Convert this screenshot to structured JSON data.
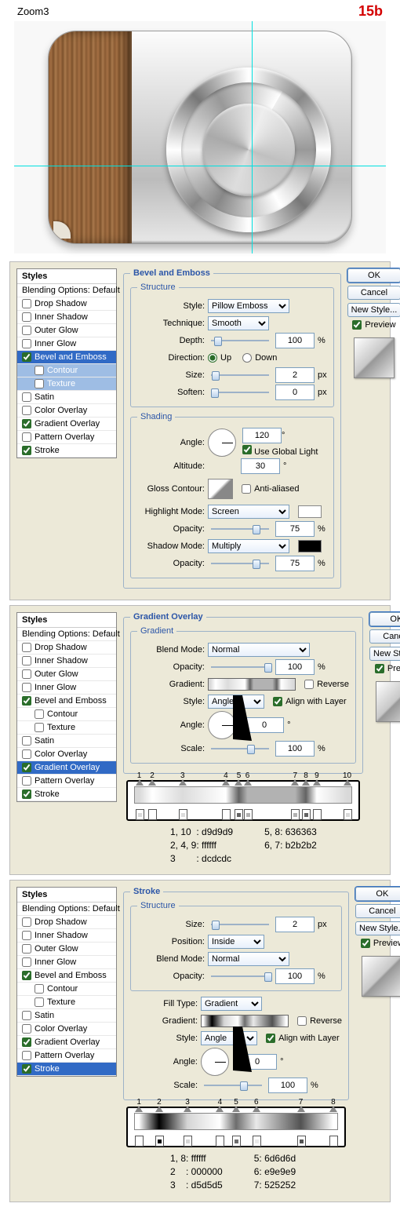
{
  "header": {
    "title": "Zoom3",
    "tag": "15b"
  },
  "buttons": {
    "ok": "OK",
    "cancel": "Cancel",
    "newstyle": "New Style...",
    "preview": "Preview"
  },
  "styles_head": "Styles",
  "blending": "Blending Options: Default",
  "items": {
    "drop": "Drop Shadow",
    "inner_sh": "Inner Shadow",
    "outer_g": "Outer Glow",
    "inner_g": "Inner Glow",
    "bevel": "Bevel and Emboss",
    "contour": "Contour",
    "texture": "Texture",
    "satin": "Satin",
    "color_ov": "Color Overlay",
    "grad_ov": "Gradient Overlay",
    "patt_ov": "Pattern Overlay",
    "stroke": "Stroke"
  },
  "p1": {
    "title": "Bevel and Emboss",
    "structure": "Structure",
    "shading": "Shading",
    "style_lbl": "Style:",
    "style_v": "Pillow Emboss",
    "tech_lbl": "Technique:",
    "tech_v": "Smooth",
    "depth_lbl": "Depth:",
    "depth_v": "100",
    "pct": "%",
    "dir_lbl": "Direction:",
    "up": "Up",
    "down": "Down",
    "size_lbl": "Size:",
    "size_v": "2",
    "px": "px",
    "soften_lbl": "Soften:",
    "soften_v": "0",
    "angle_lbl": "Angle:",
    "angle_v": "120",
    "deg": "°",
    "global": "Use Global Light",
    "alt_lbl": "Altitude:",
    "alt_v": "30",
    "gloss_lbl": "Gloss Contour:",
    "aa": "Anti-aliased",
    "hl_lbl": "Highlight Mode:",
    "hl_v": "Screen",
    "op_lbl": "Opacity:",
    "hl_op": "75",
    "sh_lbl": "Shadow Mode:",
    "sh_v": "Multiply",
    "sh_op": "75"
  },
  "p2": {
    "title": "Gradient Overlay",
    "sub": "Gradient",
    "bm_lbl": "Blend Mode:",
    "bm_v": "Normal",
    "op_lbl": "Opacity:",
    "op_v": "100",
    "pct": "%",
    "grad_lbl": "Gradient:",
    "rev": "Reverse",
    "style_lbl": "Style:",
    "style_v": "Angle",
    "align": "Align with Layer",
    "angle_lbl": "Angle:",
    "angle_v": "0",
    "deg": "°",
    "scale_lbl": "Scale:",
    "scale_v": "100",
    "stops": [
      {
        "n": "1",
        "p": 2,
        "c": "#d9d9d9"
      },
      {
        "n": "2",
        "p": 8,
        "c": "#ffffff"
      },
      {
        "n": "3",
        "p": 22,
        "c": "#dcdcdc"
      },
      {
        "n": "4",
        "p": 42,
        "c": "#ffffff"
      },
      {
        "n": "5",
        "p": 48,
        "c": "#636363"
      },
      {
        "n": "6",
        "p": 52,
        "c": "#b2b2b2"
      },
      {
        "n": "7",
        "p": 74,
        "c": "#b2b2b2"
      },
      {
        "n": "8",
        "p": 79,
        "c": "#636363"
      },
      {
        "n": "9",
        "p": 84,
        "c": "#ffffff"
      },
      {
        "n": "10",
        "p": 98,
        "c": "#d9d9d9"
      }
    ],
    "legend_l": "1, 10  : d9d9d9\n2, 4, 9: ffffff\n3        : dcdcdc",
    "legend_r": "5, 8: 636363\n6, 7: b2b2b2"
  },
  "p3": {
    "title": "Stroke",
    "structure": "Structure",
    "size_lbl": "Size:",
    "size_v": "2",
    "px": "px",
    "pos_lbl": "Position:",
    "pos_v": "Inside",
    "bm_lbl": "Blend Mode:",
    "bm_v": "Normal",
    "op_lbl": "Opacity:",
    "op_v": "100",
    "pct": "%",
    "ft_lbl": "Fill Type:",
    "ft_v": "Gradient",
    "grad_lbl": "Gradient:",
    "rev": "Reverse",
    "style_lbl": "Style:",
    "style_v": "Angle",
    "align": "Align with Layer",
    "angle_lbl": "Angle:",
    "angle_v": "0",
    "deg": "°",
    "scale_lbl": "Scale:",
    "scale_v": "100",
    "stops": [
      {
        "n": "1",
        "p": 2,
        "c": "#ffffff"
      },
      {
        "n": "2",
        "p": 12,
        "c": "#000000"
      },
      {
        "n": "3",
        "p": 26,
        "c": "#d5d5d5"
      },
      {
        "n": "4",
        "p": 42,
        "c": "#ffffff"
      },
      {
        "n": "5",
        "p": 50,
        "c": "#6d6d6d"
      },
      {
        "n": "6",
        "p": 60,
        "c": "#e9e9e9"
      },
      {
        "n": "7",
        "p": 82,
        "c": "#525252"
      },
      {
        "n": "8",
        "p": 98,
        "c": "#ffffff"
      }
    ],
    "legend_l": "1, 8: ffffff\n2    : 000000\n3    : d5d5d5",
    "legend_r": "5: 6d6d6d\n6: e9e9e9\n7: 525252"
  }
}
